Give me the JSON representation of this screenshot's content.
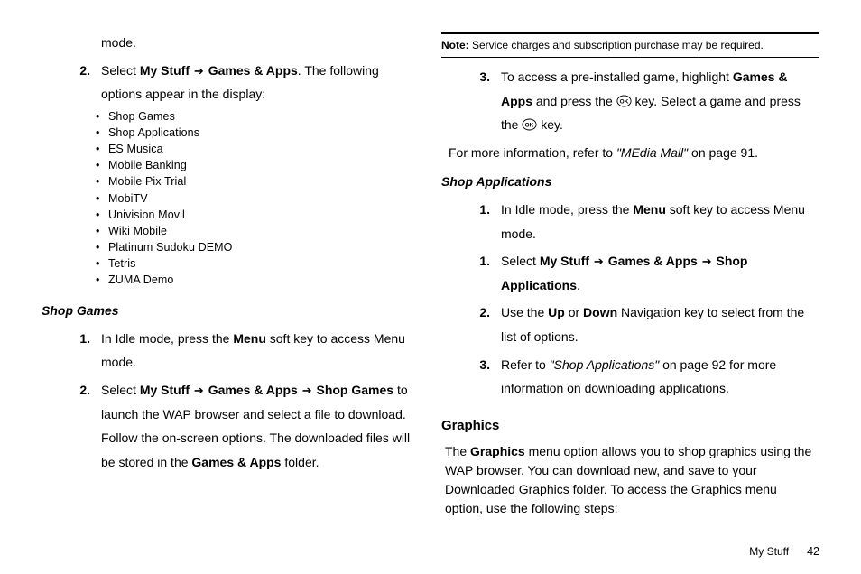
{
  "left": {
    "continued_mode": "mode.",
    "step2_a": "Select ",
    "step2_b": "My Stuff",
    "step2_c": "Games & Apps",
    "step2_d": ". The following options appear in the display:",
    "bullets": [
      "Shop Games",
      "Shop Applications",
      "ES Musica",
      "Mobile Banking",
      "Mobile Pix Trial",
      "MobiTV",
      "Univision Movil",
      "Wiki Mobile",
      "Platinum Sudoku DEMO",
      "Tetris",
      "ZUMA Demo"
    ],
    "shop_games_heading": "Shop Games",
    "sg_step1_a": "In Idle mode, press the ",
    "sg_step1_b": "Menu",
    "sg_step1_c": " soft key to access Menu mode.",
    "sg_step2_a": "Select ",
    "sg_step2_b": "My Stuff",
    "sg_step2_c": "Games & Apps",
    "sg_step2_d": "Shop Games",
    "sg_step2_e": " to launch the WAP browser and select a file to download. Follow the on-screen options. The downloaded files will be stored in the ",
    "sg_step2_f": "Games & Apps",
    "sg_step2_g": " folder."
  },
  "right": {
    "note_label": "Note:",
    "note_text": " Service charges and subscription purchase may be required.",
    "step3_a": "To access a pre-installed game, highlight ",
    "step3_b": "Games & Apps",
    "step3_c": " and press the ",
    "step3_d": " key. Select a game and press the ",
    "step3_e": " key.",
    "more_info_a": "For more information, refer to ",
    "more_info_b": "\"MEdia Mall\"",
    "more_info_c": "  on page 91.",
    "shop_apps_heading": "Shop Applications",
    "sa_step1_a": "In Idle mode, press the ",
    "sa_step1_b": "Menu",
    "sa_step1_c": " soft key to access Menu mode.",
    "sa_step1b_a": "Select ",
    "sa_step1b_b": "My Stuff",
    "sa_step1b_c": "Games & Apps",
    "sa_step1b_d": "Shop Applications",
    "sa_step1b_e": ".",
    "sa_step2_a": "Use the ",
    "sa_step2_b": "Up",
    "sa_step2_c": " or ",
    "sa_step2_d": "Down",
    "sa_step2_e": " Navigation key to select from the list of options.",
    "sa_step3_a": "Refer to ",
    "sa_step3_b": "\"Shop Applications\"",
    "sa_step3_c": " on page 92 for more information on downloading applications.",
    "graphics_heading": "Graphics",
    "graphics_para_a": "The ",
    "graphics_para_b": "Graphics",
    "graphics_para_c": " menu option allows you to shop graphics using the WAP browser. You can download new, and save to your Downloaded Graphics folder. To access the Graphics menu option, use the following steps:"
  },
  "footer": {
    "section": "My Stuff",
    "page": "42"
  },
  "nums": {
    "n1": "1.",
    "n2": "2.",
    "n3": "3."
  },
  "bullet": "•",
  "arrow": "➔"
}
